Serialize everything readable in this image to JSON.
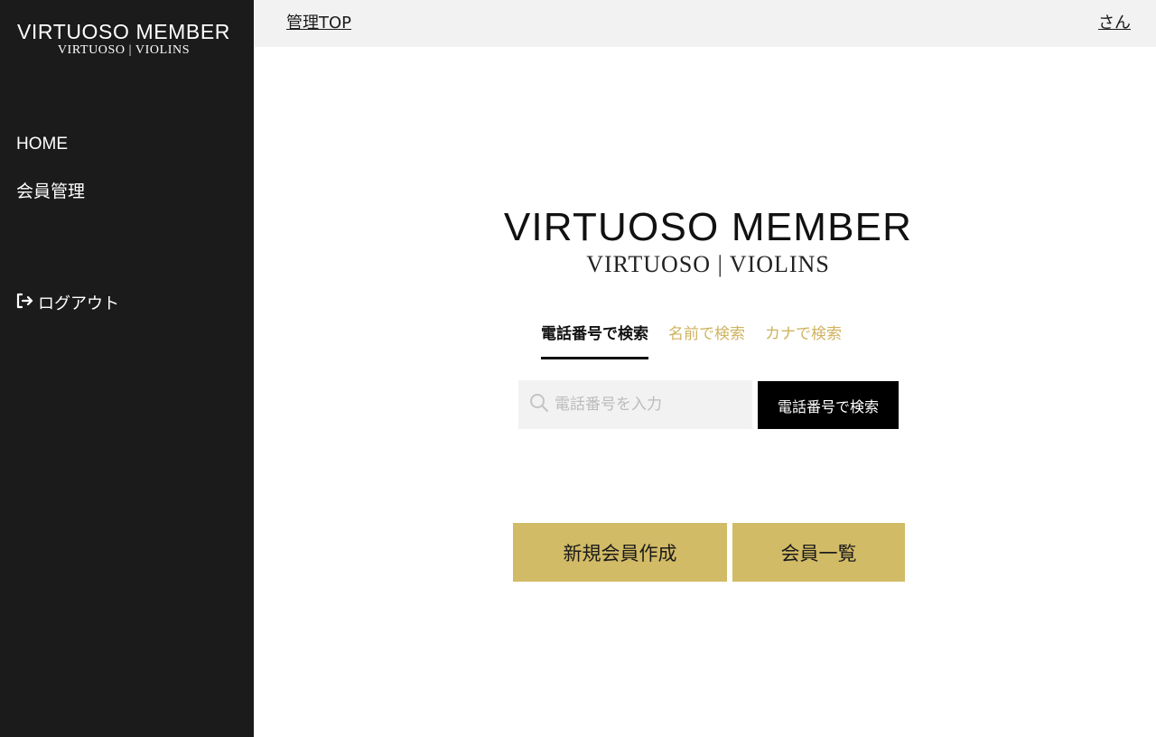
{
  "sidebar": {
    "logo_main": "VIRTUOSO MEMBER",
    "logo_sub": "VIRTUOSO | VIOLINS",
    "items": [
      {
        "label": "HOME"
      },
      {
        "label": "会員管理"
      }
    ],
    "logout_label": "ログアウト",
    "logout_icon": "sign-out-icon"
  },
  "topbar": {
    "left_link": "管理TOP",
    "right_link": "さん"
  },
  "main": {
    "logo_main": "VIRTUOSO MEMBER",
    "logo_sub": "VIRTUOSO | VIOLINS",
    "tabs": [
      {
        "label": "電話番号で検索",
        "active": true
      },
      {
        "label": "名前で検索",
        "active": false
      },
      {
        "label": "カナで検索",
        "active": false
      }
    ],
    "search": {
      "placeholder": "電話番号を入力",
      "value": "",
      "icon": "search-icon",
      "button_label": "電話番号で検索"
    },
    "actions": {
      "new_member_label": "新規会員作成",
      "member_list_label": "会員一覧"
    }
  },
  "colors": {
    "sidebar_bg": "#1b1b1b",
    "topbar_bg": "#f2f2f2",
    "accent_gold": "#d2bb66",
    "tab_inactive": "#cfb35f",
    "search_button_bg": "#000000"
  }
}
